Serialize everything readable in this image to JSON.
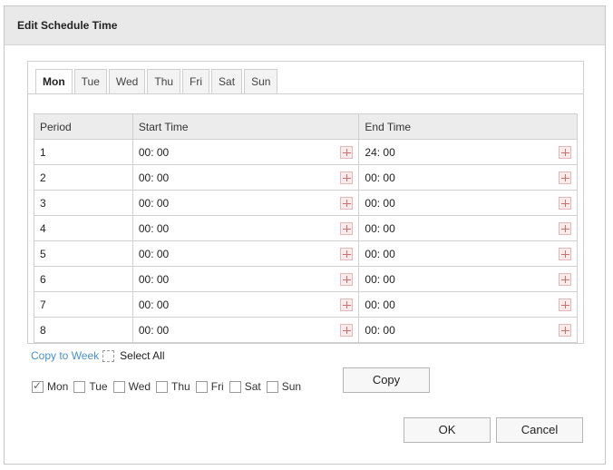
{
  "dialog": {
    "title": "Edit Schedule Time"
  },
  "tabs": [
    {
      "label": "Mon",
      "active": true
    },
    {
      "label": "Tue",
      "active": false
    },
    {
      "label": "Wed",
      "active": false
    },
    {
      "label": "Thu",
      "active": false
    },
    {
      "label": "Fri",
      "active": false
    },
    {
      "label": "Sat",
      "active": false
    },
    {
      "label": "Sun",
      "active": false
    }
  ],
  "table": {
    "headers": [
      "Period",
      "Start Time",
      "End Time"
    ],
    "rows": [
      {
        "period": "1",
        "start": "00: 00",
        "end": "24: 00"
      },
      {
        "period": "2",
        "start": "00: 00",
        "end": "00: 00"
      },
      {
        "period": "3",
        "start": "00: 00",
        "end": "00: 00"
      },
      {
        "period": "4",
        "start": "00: 00",
        "end": "00: 00"
      },
      {
        "period": "5",
        "start": "00: 00",
        "end": "00: 00"
      },
      {
        "period": "6",
        "start": "00: 00",
        "end": "00: 00"
      },
      {
        "period": "7",
        "start": "00: 00",
        "end": "00: 00"
      },
      {
        "period": "8",
        "start": "00: 00",
        "end": "00: 00"
      }
    ]
  },
  "copy": {
    "link_label": "Copy to Week",
    "select_all_label": "Select All",
    "days": [
      {
        "label": "Mon",
        "checked": true
      },
      {
        "label": "Tue",
        "checked": false
      },
      {
        "label": "Wed",
        "checked": false
      },
      {
        "label": "Thu",
        "checked": false
      },
      {
        "label": "Fri",
        "checked": false
      },
      {
        "label": "Sat",
        "checked": false
      },
      {
        "label": "Sun",
        "checked": false
      }
    ],
    "copy_button": "Copy"
  },
  "footer": {
    "ok": "OK",
    "cancel": "Cancel"
  },
  "colors": {
    "link": "#4a90c9",
    "title_bar": "#e9e9e9",
    "header_bg": "#ececec",
    "time_icon": "#c97070"
  },
  "icons": {
    "time_picker": "clock-picker-icon",
    "check": "check-icon"
  }
}
